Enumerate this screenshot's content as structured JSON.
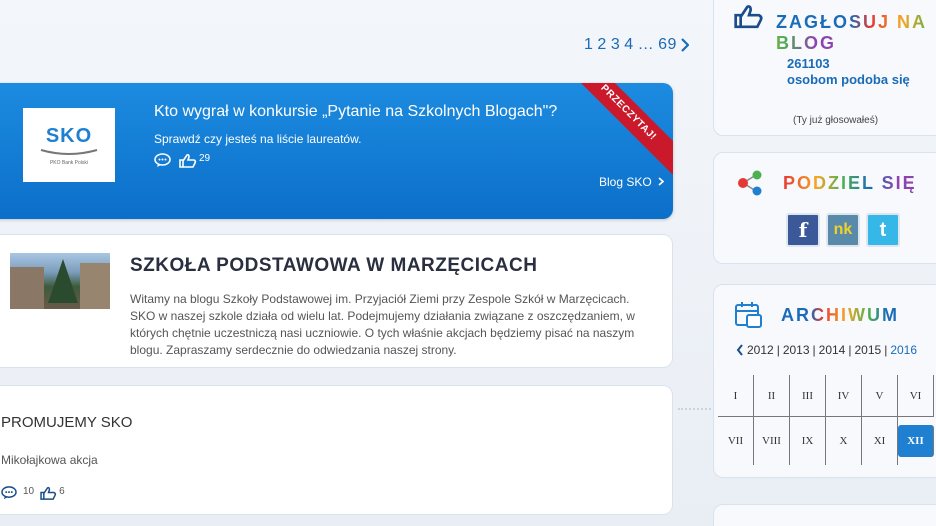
{
  "pagination": {
    "pages": [
      "1",
      "2",
      "3",
      "4",
      "…",
      "69"
    ]
  },
  "featured": {
    "logo_word": "SKO",
    "logo_sub": "PKO Bank Polski",
    "title": "Kto wygrał w konkursie „Pytanie na Szkolnych Blogach\"?",
    "subtitle": "Sprawdź czy jesteś na liście laureatów.",
    "likes": "29",
    "link": "Blog SKO",
    "ribbon": "PRZECZYTAJ!"
  },
  "school": {
    "title": "SZKOŁA PODSTAWOWA W MARZĘCICACH",
    "description": "Witamy na blogu Szkoły Podstawowej im. Przyjaciół Ziemi przy Zespole Szkół w Marzęcicach. SKO w naszej szkole działa od wielu lat. Podejmujemy działania związane z oszczędzaniem, w których chętnie uczestniczą nasi uczniowie. O tych właśnie akcjach będziemy pisać na naszym blogu. Zapraszamy serdecznie do odwiedzania naszej strony."
  },
  "promo": {
    "title": "PROMUJEMY SKO",
    "item": "Mikołajkowa akcja",
    "comments": "10",
    "likes": "6"
  },
  "vote": {
    "title": "ZAGŁOSUJ NA BLOG",
    "count": "261103",
    "text": "osobom podoba się",
    "note": "(Ty już głosowałeś)"
  },
  "share": {
    "title": "PODZIEL SIĘ",
    "buttons": [
      "f",
      "nk",
      "t"
    ]
  },
  "archive": {
    "title": "ARCHIWUM",
    "years": [
      "2012",
      "2013",
      "2014",
      "2015",
      "2016"
    ],
    "active_year": "2016",
    "months": [
      "I",
      "II",
      "III",
      "IV",
      "V",
      "VI",
      "VII",
      "VIII",
      "IX",
      "X",
      "XI",
      "XII"
    ],
    "selected_month": "XII"
  },
  "colors": {
    "accent": "#1a6bb8",
    "featured_bg": "#0c6fc9",
    "ribbon": "#c9192b"
  }
}
